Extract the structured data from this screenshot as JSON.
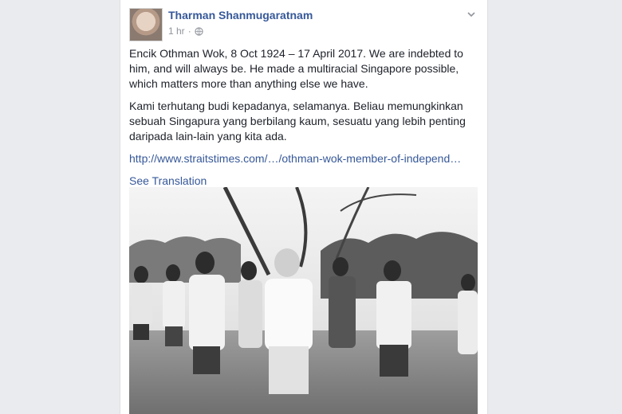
{
  "post": {
    "author": "Tharman Shanmugaratnam",
    "timestamp": "1 hr",
    "separator": "·",
    "privacy_icon": "globe-icon",
    "menu_icon": "chevron-down-icon",
    "paragraph_en": "Encik Othman Wok, 8 Oct 1924 – 17 April 2017. We are indebted to him, and will always be. He made a multiracial Singapore possible, which matters more than anything else we have.",
    "paragraph_ms": "Kami terhutang budi kepadanya, selamanya. Beliau memungkinkan sebuah Singapura yang berbilang kaum, sesuatu yang lebih penting daripada lain-lain yang kita ada.",
    "link": "http://www.straitstimes.com/…/othman-wok-member-of-independ…",
    "see_translation": "See Translation"
  },
  "colors": {
    "link": "#365899",
    "text": "#1d2129",
    "meta": "#90949c",
    "background": "#e9ebee"
  }
}
